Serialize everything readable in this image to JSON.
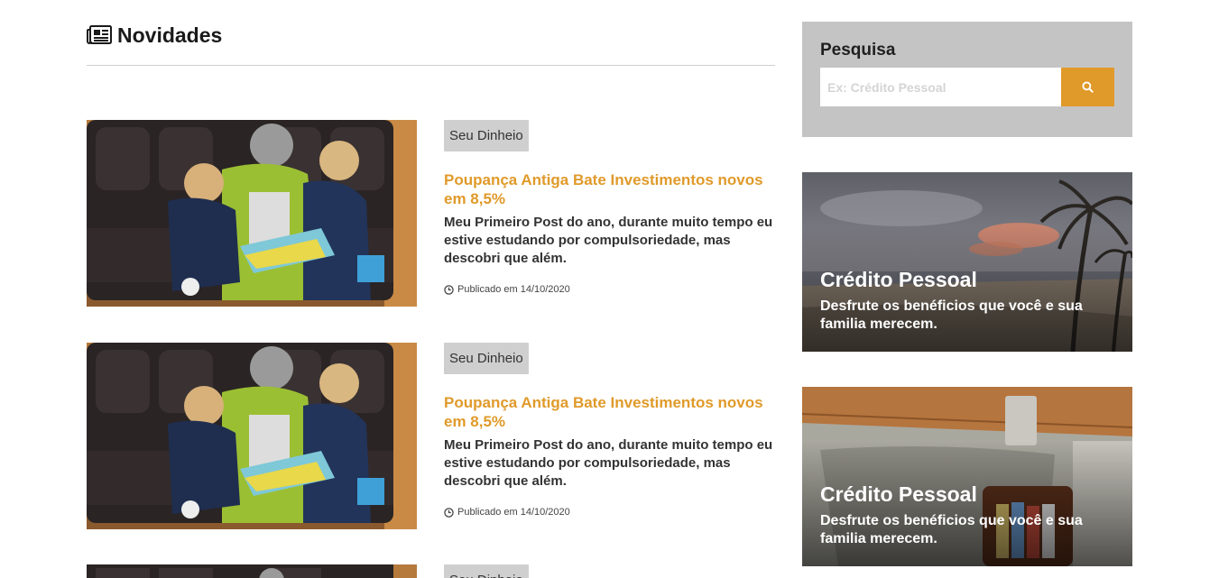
{
  "main": {
    "section_title": "Novidades",
    "posts": [
      {
        "tag": "Seu Dinheio",
        "title": "Poupança Antiga Bate Investimentos novos em 8,5%",
        "excerpt": "Meu Primeiro Post do ano, durante muito tempo eu estive estudando por compulsoriedade, mas descobri que além.",
        "meta": "Publicado em 14/10/2020"
      },
      {
        "tag": "Seu Dinheio",
        "title": "Poupança Antiga Bate Investimentos novos em 8,5%",
        "excerpt": "Meu Primeiro Post do ano, durante muito tempo eu estive estudando por compulsoriedade, mas descobri que além.",
        "meta": "Publicado em 14/10/2020"
      },
      {
        "tag": "Seu Dinheio",
        "title": "",
        "excerpt": "",
        "meta": ""
      }
    ]
  },
  "sidebar": {
    "search": {
      "title": "Pesquisa",
      "placeholder": "Ex: Crédito Pessoal"
    },
    "promos": [
      {
        "title": "Crédito Pessoal",
        "description": "Desfrute os benéficios que você e sua familia merecem."
      },
      {
        "title": "Crédito Pessoal",
        "description": "Desfrute os benéficios que você e sua familia merecem."
      }
    ]
  },
  "colors": {
    "accent": "#e09a2a",
    "tag_bg": "#cfcfcf",
    "search_bg": "#c4c4c4"
  },
  "icons": {
    "section": "newspaper-icon",
    "meta": "clock-icon",
    "search": "search-icon"
  }
}
